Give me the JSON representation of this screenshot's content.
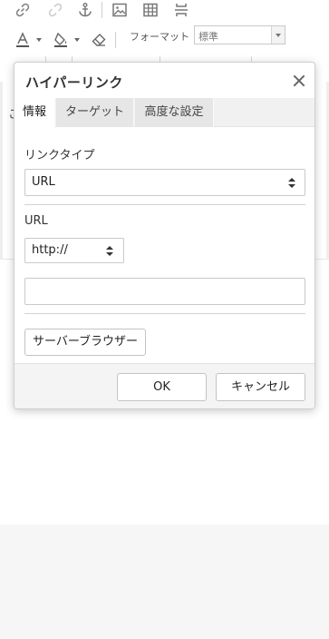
{
  "toolbar": {
    "format_label": "フォーマット",
    "format_value": "標準",
    "icons": [
      "link-icon",
      "unlink-icon",
      "anchor-icon",
      "image-icon",
      "table-icon",
      "page-break-icon",
      "text-color-icon",
      "background-color-icon",
      "remove-format-icon"
    ]
  },
  "editor": {
    "visible_char": "こ"
  },
  "dialog": {
    "title": "ハイパーリンク",
    "tabs": [
      {
        "label": "情報",
        "active": true
      },
      {
        "label": "ターゲット",
        "active": false
      },
      {
        "label": "高度な設定",
        "active": false
      }
    ],
    "link_type": {
      "label": "リンクタイプ",
      "value": "URL"
    },
    "url": {
      "label": "URL",
      "protocol": "http://",
      "value": ""
    },
    "server_browser_label": "サーバーブラウザー",
    "ok_label": "OK",
    "cancel_label": "キャンセル"
  },
  "colors": {
    "dialog_bg": "#ffffff",
    "tab_inactive": "#e6e6e6",
    "footer_bg": "#f4f4f4",
    "page_bottom": "#f6f6f6"
  }
}
